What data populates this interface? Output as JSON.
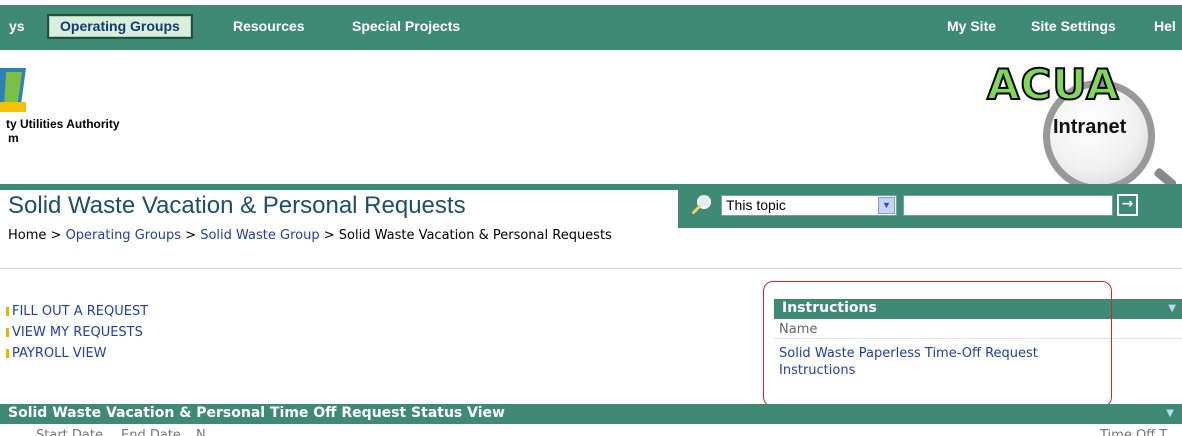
{
  "nav": {
    "items": [
      {
        "label": "ys"
      },
      {
        "label": "Operating Groups",
        "active": true
      },
      {
        "label": "Resources"
      },
      {
        "label": "Special Projects"
      }
    ],
    "right_items": [
      {
        "label": "My Site"
      },
      {
        "label": "Site Settings"
      },
      {
        "label": "Hel"
      }
    ]
  },
  "header": {
    "org_name": "ty Utilities Authority",
    "org_sub": "m",
    "brand_name": "ACUA",
    "brand_sub": "Intranet"
  },
  "page": {
    "title": "Solid Waste Vacation & Personal Requests",
    "breadcrumb": [
      {
        "label": "Home",
        "link": false
      },
      {
        "label": "Operating Groups",
        "link": true
      },
      {
        "label": "Solid Waste Group",
        "link": true
      },
      {
        "label": "Solid Waste Vacation & Personal Requests",
        "link": false
      }
    ],
    "breadcrumb_sep": " > "
  },
  "search": {
    "scope_value": "This topic",
    "go_label": "→"
  },
  "quick_links": [
    {
      "label": "FILL OUT A REQUEST"
    },
    {
      "label": "VIEW MY REQUESTS"
    },
    {
      "label": "PAYROLL VIEW"
    }
  ],
  "instructions": {
    "title": "Instructions",
    "column": "Name",
    "items": [
      {
        "label": "Solid Waste Paperless Time-Off Request Instructions"
      }
    ]
  },
  "status_view": {
    "title": "Solid Waste Vacation & Personal Time Off Request Status View",
    "columns": [
      "Start Date",
      "End Date",
      "N",
      "Time Off T"
    ]
  },
  "colors": {
    "bar_green": "#3f8a72",
    "link_blue": "#1f3fa8",
    "title_blue": "#1a4f6e",
    "highlight_red": "#d02828",
    "bullet_yellow": "#e8b400"
  }
}
